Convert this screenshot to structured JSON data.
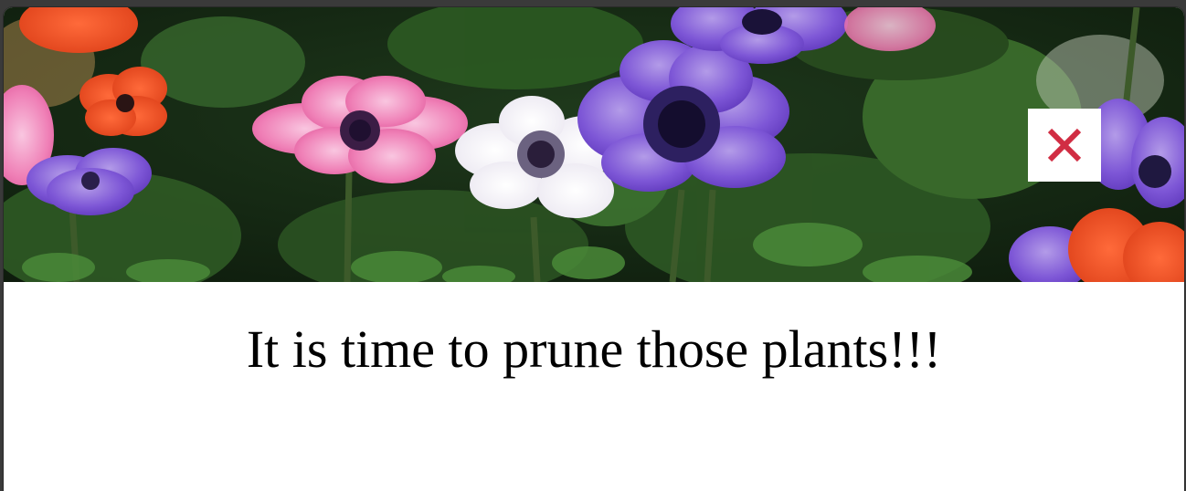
{
  "modal": {
    "heading": "It is time to prune those plants!!!",
    "close_icon": "close-x-icon",
    "hero_image": "anemone-flowers-photo"
  },
  "colors": {
    "close_x": "#d12d43",
    "close_bg": "#ffffff",
    "modal_bg": "#ffffff",
    "backdrop": "#3a3a3a"
  }
}
